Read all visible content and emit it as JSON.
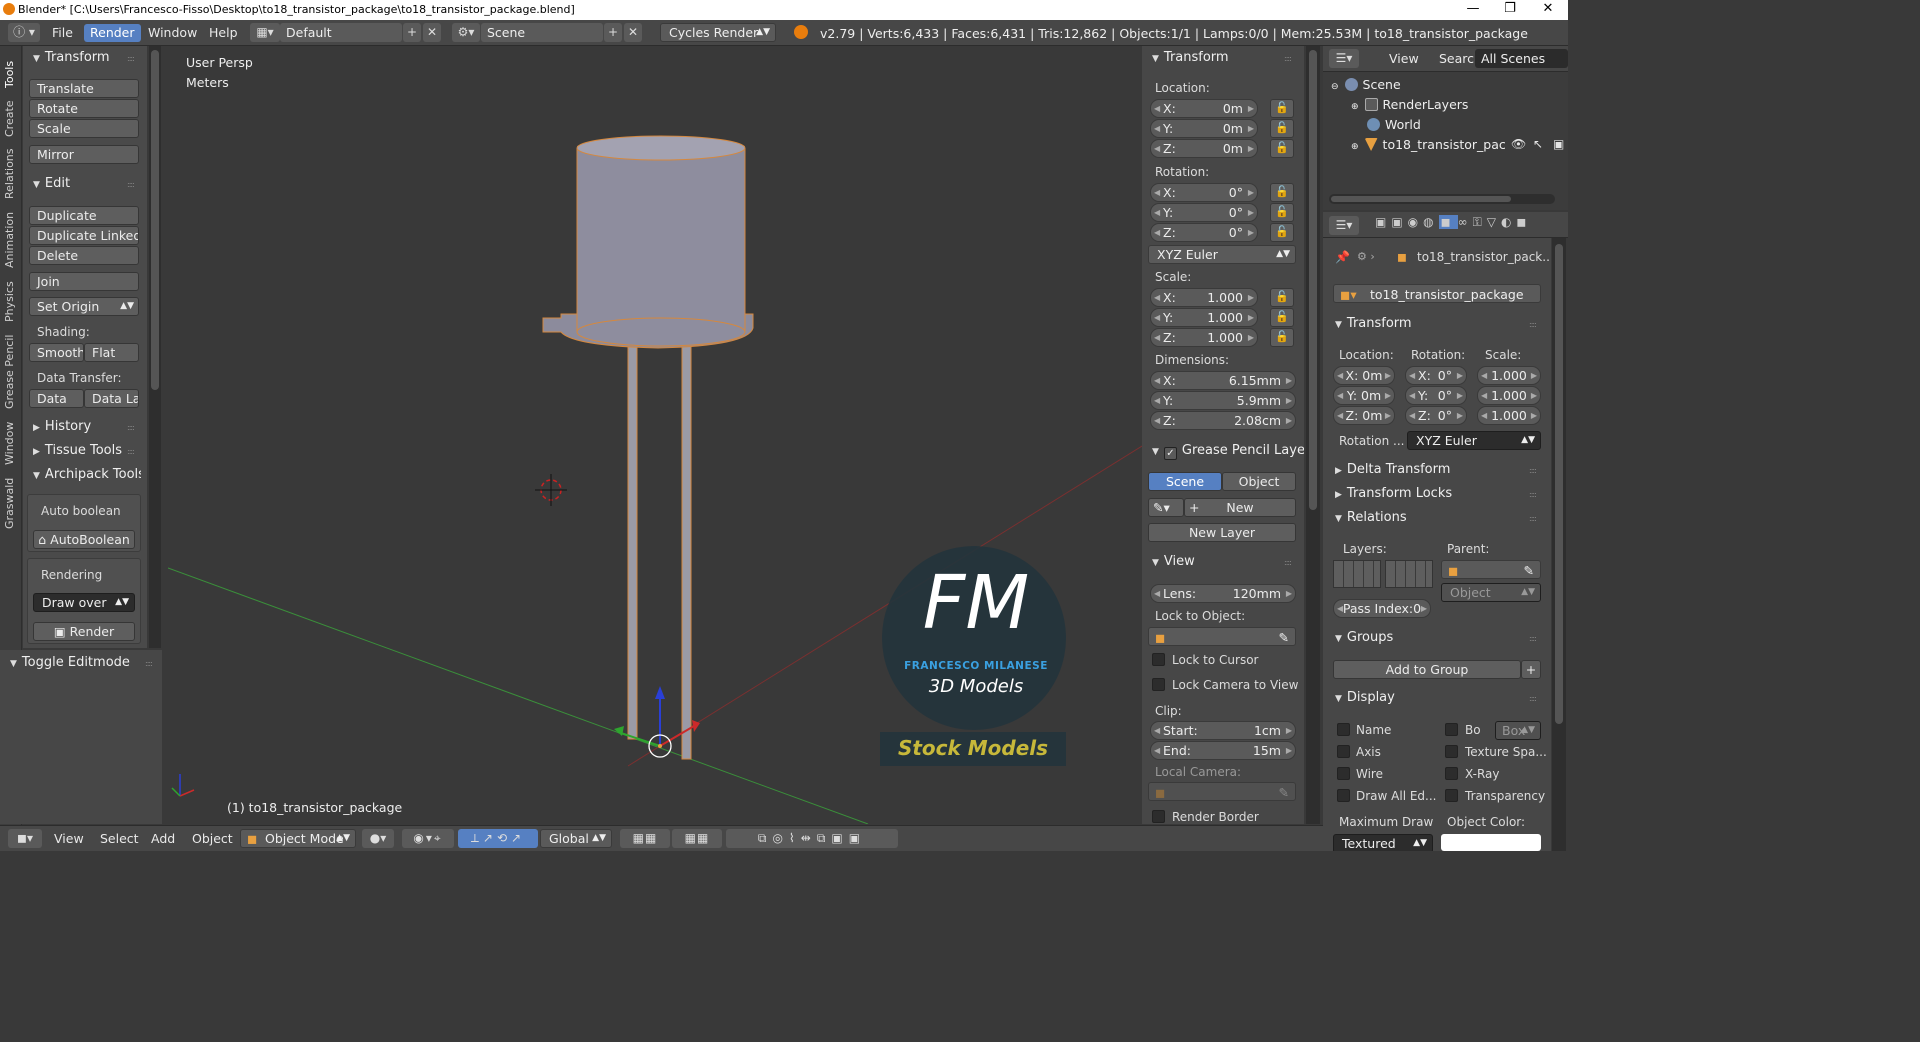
{
  "window": {
    "title": "Blender* [C:\\Users\\Francesco-Fisso\\Desktop\\to18_transistor_package\\to18_transistor_package.blend]",
    "minimize": "—",
    "maximize": "❐",
    "close": "✕"
  },
  "infobar": {
    "menus": [
      "File",
      "Render",
      "Window",
      "Help"
    ],
    "screen_layout": "Default",
    "scene": "Scene",
    "render_engine": "Cycles Render",
    "stats": "v2.79 | Verts:6,433 | Faces:6,431 | Tris:12,862 | Objects:1/1 | Lamps:0/0 | Mem:25.53M | to18_transistor_package"
  },
  "left_tabs": [
    "Tools",
    "Create",
    "Relations",
    "Animation",
    "Physics",
    "Grease Pencil",
    "Window",
    "Graswald"
  ],
  "tool_shelf": {
    "transform_header": "Transform",
    "translate": "Translate",
    "rotate": "Rotate",
    "scale": "Scale",
    "mirror": "Mirror",
    "edit_header": "Edit",
    "duplicate": "Duplicate",
    "duplicate_linked": "Duplicate Linked",
    "delete": "Delete",
    "join": "Join",
    "set_origin": "Set Origin",
    "shading_label": "Shading:",
    "smooth": "Smooth",
    "flat": "Flat",
    "data_transfer_label": "Data Transfer:",
    "data": "Data",
    "data_la": "Data La",
    "history": "History",
    "tissue_tools": "Tissue Tools",
    "archipack_tools": "Archipack Tools",
    "auto_boolean_label": "Auto boolean",
    "autoboolean_btn": "AutoBoolean",
    "rendering_label": "Rendering",
    "draw_over": "Draw over",
    "render_btn": "Render",
    "toggle_editmode": "Toggle Editmode"
  },
  "viewport": {
    "view_name": "User Persp",
    "units": "Meters",
    "object_label": "(1) to18_transistor_package",
    "watermark": {
      "initials": "FM",
      "name": "FRANCESCO MILANESE",
      "sub": "3D Models",
      "tag": "Stock Models"
    }
  },
  "properties_n": {
    "transform_header": "Transform",
    "location_label": "Location:",
    "location": [
      {
        "k": "X:",
        "v": "0m"
      },
      {
        "k": "Y:",
        "v": "0m"
      },
      {
        "k": "Z:",
        "v": "0m"
      }
    ],
    "rotation_label": "Rotation:",
    "rotation": [
      {
        "k": "X:",
        "v": "0°"
      },
      {
        "k": "Y:",
        "v": "0°"
      },
      {
        "k": "Z:",
        "v": "0°"
      }
    ],
    "rotation_mode": "XYZ Euler",
    "scale_label": "Scale:",
    "scale": [
      {
        "k": "X:",
        "v": "1.000"
      },
      {
        "k": "Y:",
        "v": "1.000"
      },
      {
        "k": "Z:",
        "v": "1.000"
      }
    ],
    "dimensions_label": "Dimensions:",
    "dimensions": [
      {
        "k": "X:",
        "v": "6.15mm"
      },
      {
        "k": "Y:",
        "v": "5.9mm"
      },
      {
        "k": "Z:",
        "v": "2.08cm"
      }
    ],
    "grease_header": "Grease Pencil Layer",
    "gp_scene": "Scene",
    "gp_object": "Object",
    "gp_new": "New",
    "gp_new_layer": "New Layer",
    "view_header": "View",
    "lens_label": "Lens:",
    "lens_value": "120mm",
    "lock_to_object": "Lock to Object:",
    "lock_to_cursor": "Lock to Cursor",
    "lock_camera": "Lock Camera to View",
    "clip_label": "Clip:",
    "clip_start_k": "Start:",
    "clip_start_v": "1cm",
    "clip_end_k": "End:",
    "clip_end_v": "15m",
    "local_camera": "Local Camera:",
    "render_border": "Render Border"
  },
  "outliner": {
    "view": "View",
    "search": "Search",
    "all_scenes": "All Scenes",
    "items": [
      "Scene",
      "RenderLayers",
      "World",
      "to18_transistor_package"
    ]
  },
  "object_props": {
    "breadcrumb": "to18_transistor_pack...",
    "object_name": "to18_transistor_package",
    "transform_header": "Transform",
    "location_label": "Location:",
    "rotation_label": "Rotation:",
    "scale_label": "Scale:",
    "loc": [
      "X: 0m",
      "Y: 0m",
      "Z: 0m"
    ],
    "rot_k": [
      "X:",
      "Y:",
      "Z:"
    ],
    "rot_v": [
      "0°",
      "0°",
      "0°"
    ],
    "scl": [
      "1.000",
      "1.000",
      "1.000"
    ],
    "rotation_mode_label": "Rotation ...",
    "rotation_mode": "XYZ Euler",
    "delta_transform": "Delta Transform",
    "transform_locks": "Transform Locks",
    "relations": "Relations",
    "layers_label": "Layers:",
    "parent_label": "Parent:",
    "parent_type": "Object",
    "pass_index": "Pass Index:0",
    "groups": "Groups",
    "add_to_group": "Add to Group",
    "display": "Display",
    "name": "Name",
    "bo": "Bo",
    "box": "Box",
    "axis": "Axis",
    "texture_space": "Texture Spa...",
    "wire": "Wire",
    "xray": "X-Ray",
    "draw_all_edges": "Draw All Ed...",
    "transparency": "Transparency",
    "max_draw": "Maximum Draw",
    "object_color": "Object Color:",
    "textured": "Textured"
  },
  "bottom_bar": {
    "view": "View",
    "select": "Select",
    "add": "Add",
    "object": "Object",
    "mode": "Object Mode",
    "orientation": "Global"
  }
}
